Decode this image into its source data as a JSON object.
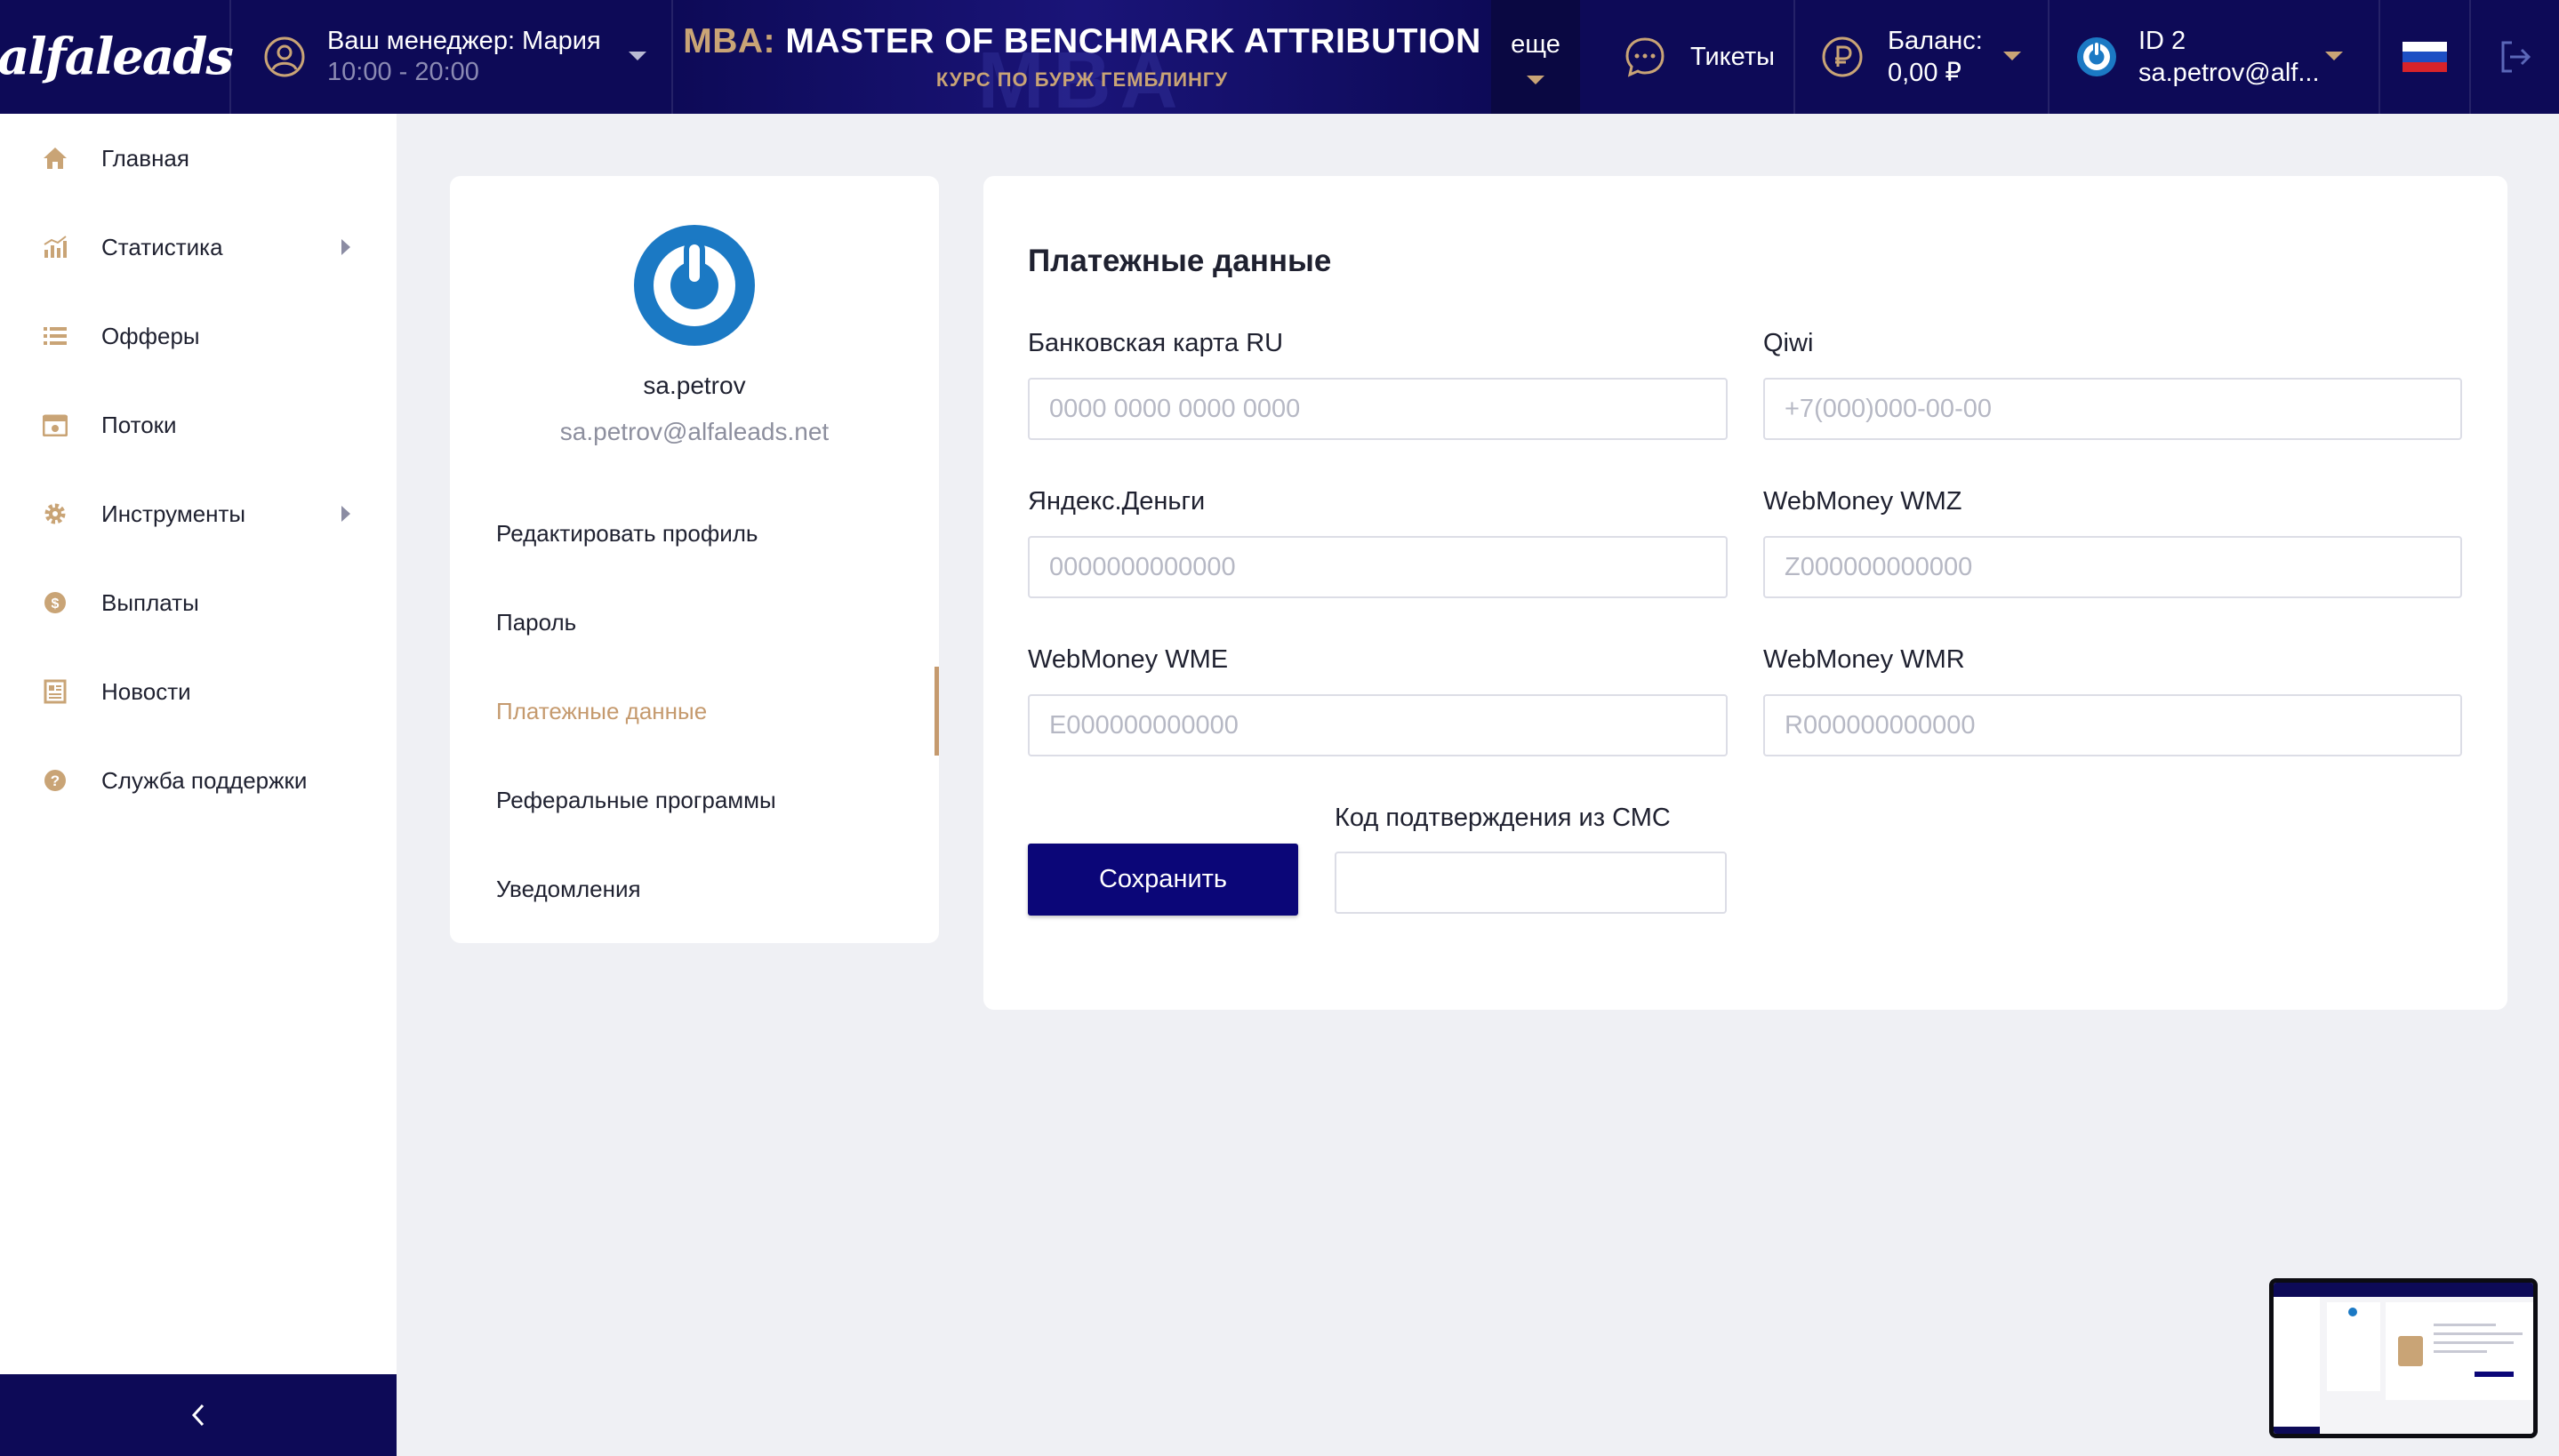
{
  "topbar": {
    "logo": "alfaleads",
    "manager_label": "Ваш менеджер: Мария",
    "manager_hours": "10:00 - 20:00",
    "banner_prefix": "MBA:",
    "banner_title": "MASTER OF BENCHMARK ATTRIBUTION",
    "banner_subtitle": "КУРС ПО БУРЖ ГЕМБЛИНГУ",
    "more_label": "еще",
    "tickets_label": "Тикеты",
    "balance_label": "Баланс:",
    "balance_value": "0,00 ₽",
    "account_id": "ID 2",
    "account_email": "sa.petrov@alf..."
  },
  "sidebar": {
    "items": [
      {
        "label": "Главная",
        "icon": "home-icon",
        "submenu": false
      },
      {
        "label": "Статистика",
        "icon": "stats-icon",
        "submenu": true
      },
      {
        "label": "Офферы",
        "icon": "list-icon",
        "submenu": false
      },
      {
        "label": "Потоки",
        "icon": "streams-icon",
        "submenu": false
      },
      {
        "label": "Инструменты",
        "icon": "gear-icon",
        "submenu": true
      },
      {
        "label": "Выплаты",
        "icon": "coin-icon",
        "submenu": false
      },
      {
        "label": "Новости",
        "icon": "news-icon",
        "submenu": false
      },
      {
        "label": "Служба поддержки",
        "icon": "help-icon",
        "submenu": false
      }
    ]
  },
  "profile": {
    "username": "sa.petrov",
    "email": "sa.petrov@alfaleads.net",
    "menu": [
      {
        "label": "Редактировать профиль",
        "active": false
      },
      {
        "label": "Пароль",
        "active": false
      },
      {
        "label": "Платежные данные",
        "active": true
      },
      {
        "label": "Реферальные программы",
        "active": false
      },
      {
        "label": "Уведомления",
        "active": false
      }
    ]
  },
  "payment": {
    "title": "Платежные данные",
    "fields": [
      {
        "label": "Банковская карта RU",
        "placeholder": "0000 0000 0000 0000",
        "value": ""
      },
      {
        "label": "Qiwi",
        "placeholder": "+7(000)000-00-00",
        "value": ""
      },
      {
        "label": "Яндекс.Деньги",
        "placeholder": "0000000000000",
        "value": ""
      },
      {
        "label": "WebMoney WMZ",
        "placeholder": "Z000000000000",
        "value": ""
      },
      {
        "label": "WebMoney WME",
        "placeholder": "E000000000000",
        "value": ""
      },
      {
        "label": "WebMoney WMR",
        "placeholder": "R000000000000",
        "value": ""
      }
    ],
    "save_label": "Сохранить",
    "sms_label": "Код подтверждения из СМС",
    "sms_value": ""
  },
  "colors": {
    "navy": "#0d0a57",
    "accent_gold": "#c59a6e",
    "button": "#0b0678",
    "background": "#eff0f4"
  }
}
